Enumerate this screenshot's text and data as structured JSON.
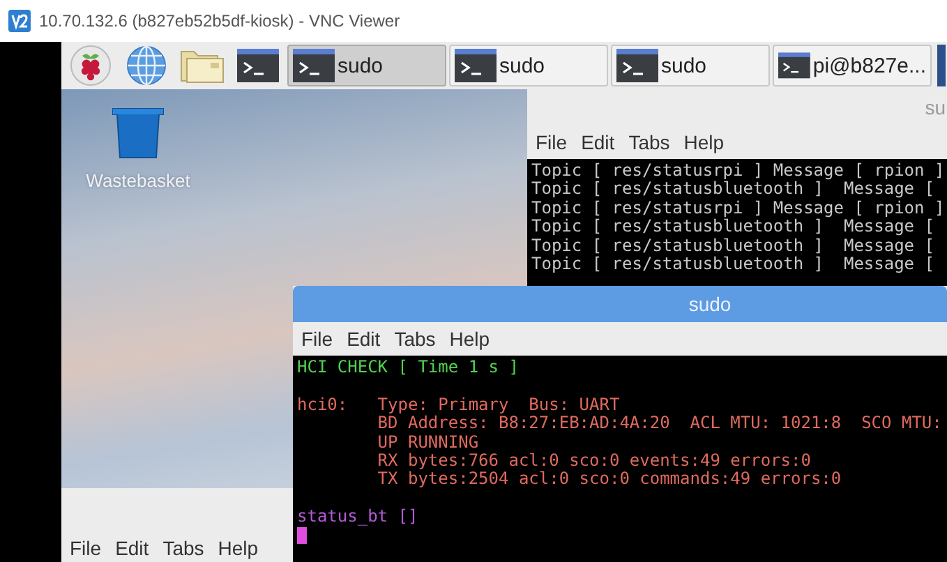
{
  "viewer": {
    "title": "10.70.132.6 (b827eb52b5df-kiosk) - VNC Viewer"
  },
  "taskbar": {
    "launchers": [
      {
        "kind": "raspberry"
      },
      {
        "kind": "globe"
      },
      {
        "kind": "folder"
      },
      {
        "kind": "terminal"
      }
    ],
    "tasks": [
      {
        "label": "sudo",
        "selected": true
      },
      {
        "label": "sudo",
        "selected": false
      },
      {
        "label": "sudo",
        "selected": false
      },
      {
        "label": "pi@b827e...",
        "selected": false
      }
    ]
  },
  "desktop": {
    "icons": [
      {
        "kind": "wastebasket",
        "label": "Wastebasket"
      }
    ]
  },
  "windows": [
    {
      "title": "su",
      "active": false,
      "menu": [
        "File",
        "Edit",
        "Tabs",
        "Help"
      ],
      "cursor": false,
      "lines": [
        {
          "kind": "plain",
          "text": "Topic [ res/statusrpi ] Message [ rpion ]"
        },
        {
          "kind": "plain",
          "text": "Topic [ res/statusbluetooth ]  Message ["
        },
        {
          "kind": "plain",
          "text": "Topic [ res/statusrpi ] Message [ rpion ]"
        },
        {
          "kind": "plain",
          "text": "Topic [ res/statusbluetooth ]  Message ["
        },
        {
          "kind": "plain",
          "text": "Topic [ res/statusbluetooth ]  Message ["
        },
        {
          "kind": "plain",
          "text": "Topic [ res/statusbluetooth ]  Message ["
        }
      ]
    },
    {
      "active": false,
      "menu": [
        "File",
        "Edit",
        "Tabs",
        "Help"
      ],
      "cursor": false
    },
    {
      "title": "sudo",
      "active": true,
      "menu": [
        "File",
        "Edit",
        "Tabs",
        "Help"
      ],
      "cursor": true,
      "lines": [
        {
          "kind": "heading",
          "text": "HCI CHECK [ Time 1 s ]"
        },
        {
          "kind": "blank"
        },
        {
          "kind": "info",
          "text": "hci0:   Type: Primary  Bus: UART"
        },
        {
          "kind": "info",
          "text": "        BD Address: B8:27:EB:AD:4A:20  ACL MTU: 1021:8  SCO MTU:"
        },
        {
          "kind": "info",
          "text": "        UP RUNNING"
        },
        {
          "kind": "info",
          "text": "        RX bytes:766 acl:0 sco:0 events:49 errors:0"
        },
        {
          "kind": "info",
          "text": "        TX bytes:2504 acl:0 sco:0 commands:49 errors:0"
        },
        {
          "kind": "blank"
        },
        {
          "kind": "status",
          "text": "status_bt []"
        }
      ]
    }
  ]
}
